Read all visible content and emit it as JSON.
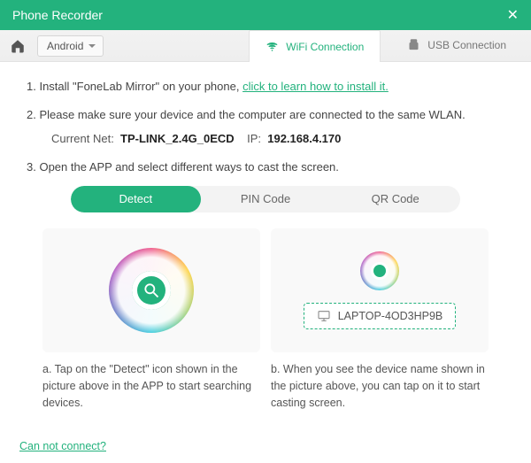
{
  "window": {
    "title": "Phone Recorder"
  },
  "toolbar": {
    "device": "Android"
  },
  "conn_tabs": {
    "wifi": "WiFi Connection",
    "usb": "USB Connection"
  },
  "steps": {
    "s1_prefix": "1. Install \"FoneLab Mirror\" on your phone, ",
    "s1_link": "click to learn how to install it.",
    "s2": "2. Please make sure your device and the computer are connected to the same WLAN.",
    "net_label": "Current Net:",
    "net_value": "TP-LINK_2.4G_0ECD",
    "ip_label": "IP:",
    "ip_value": "192.168.4.170",
    "s3": "3. Open the APP and select different ways to cast the screen."
  },
  "method_tabs": {
    "detect": "Detect",
    "pin": "PIN Code",
    "qr": "QR Code"
  },
  "device_name": "LAPTOP-4OD3HP9B",
  "captions": {
    "a": "a. Tap on the \"Detect\" icon shown in the picture above in the APP to start searching devices.",
    "b": "b. When you see the device name shown in the picture above, you can tap on it to start casting screen."
  },
  "footer": {
    "help": "Can not connect?"
  }
}
